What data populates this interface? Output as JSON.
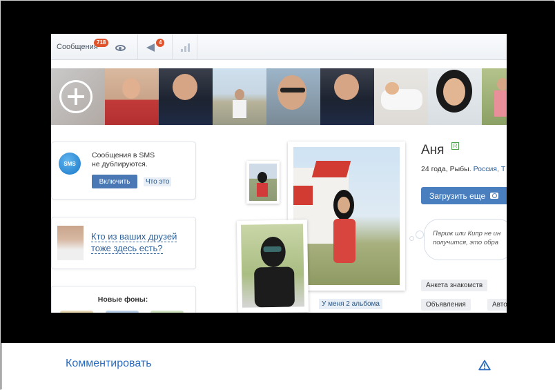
{
  "topbar": {
    "messages_label": "Сообщения",
    "messages_count": "718",
    "notifications_count": "4"
  },
  "strip": {
    "photos": [
      "add-photo",
      "woman-red-dress",
      "woman-dark-top",
      "man-monument",
      "man-sunglasses",
      "woman-dark-top-2",
      "woman-pillow",
      "woman-dark-hair",
      "woman-pink"
    ]
  },
  "sms_card": {
    "text_line1": "Сообщения в SMS",
    "text_line2": "не дублируются.",
    "enable_button": "Включить",
    "what_link": "Что это"
  },
  "friends_card": {
    "question_line1": "Кто из ваших друзей",
    "question_line2": "тоже здесь есть?"
  },
  "backgrounds_card": {
    "title": "Новые фоны:"
  },
  "photos": {
    "albums_link": "У меня 2 альбома"
  },
  "profile": {
    "name": "Аня",
    "badge": "R",
    "info_prefix": "24 года, Рыбы.",
    "info_city": "Россия, Т",
    "upload_button": "Загрузить еще",
    "status_line1": "Париж или Кипр не ин",
    "status_line2": "получится, это обра",
    "chip_profile": "Анкета знакомств",
    "chip_ads": "Объявления",
    "chip_auto": "Авто"
  },
  "footer": {
    "comment_link": "Комментировать",
    "warning_icon": "warning-triangle-icon"
  },
  "colors": {
    "accent": "#2a6cbf",
    "badge": "#e0522a",
    "button": "#4a78b5"
  }
}
